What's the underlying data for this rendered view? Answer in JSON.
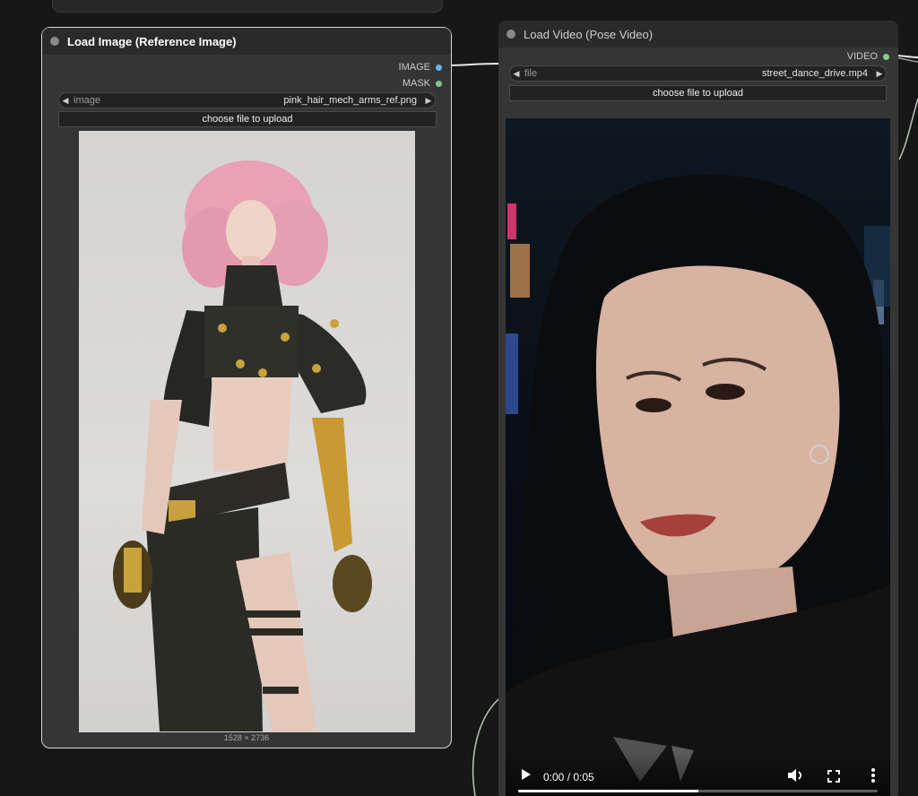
{
  "nodes": {
    "load_image": {
      "title": "Load Image (Reference Image)",
      "outputs": [
        {
          "label": "IMAGE",
          "color": "#64b5f6"
        },
        {
          "label": "MASK",
          "color": "#81c784"
        }
      ],
      "widget": {
        "label": "image",
        "value": "pink_hair_mech_arms_ref.png"
      },
      "upload_label": "choose file to upload",
      "dimensions": "1528 × 2736"
    },
    "load_video": {
      "title": "Load Video (Pose Video)",
      "outputs": [
        {
          "label": "VIDEO",
          "color": "#7fd38a"
        }
      ],
      "widget": {
        "label": "file",
        "value": "street_dance_drive.mp4"
      },
      "upload_label": "choose file to upload",
      "player": {
        "time": "0:00 / 0:05",
        "progress": 0.5
      }
    }
  },
  "icons": [
    "play-icon",
    "volume-icon",
    "fullscreen-icon",
    "more-vert-icon",
    "left-arrow-icon",
    "right-arrow-icon"
  ]
}
